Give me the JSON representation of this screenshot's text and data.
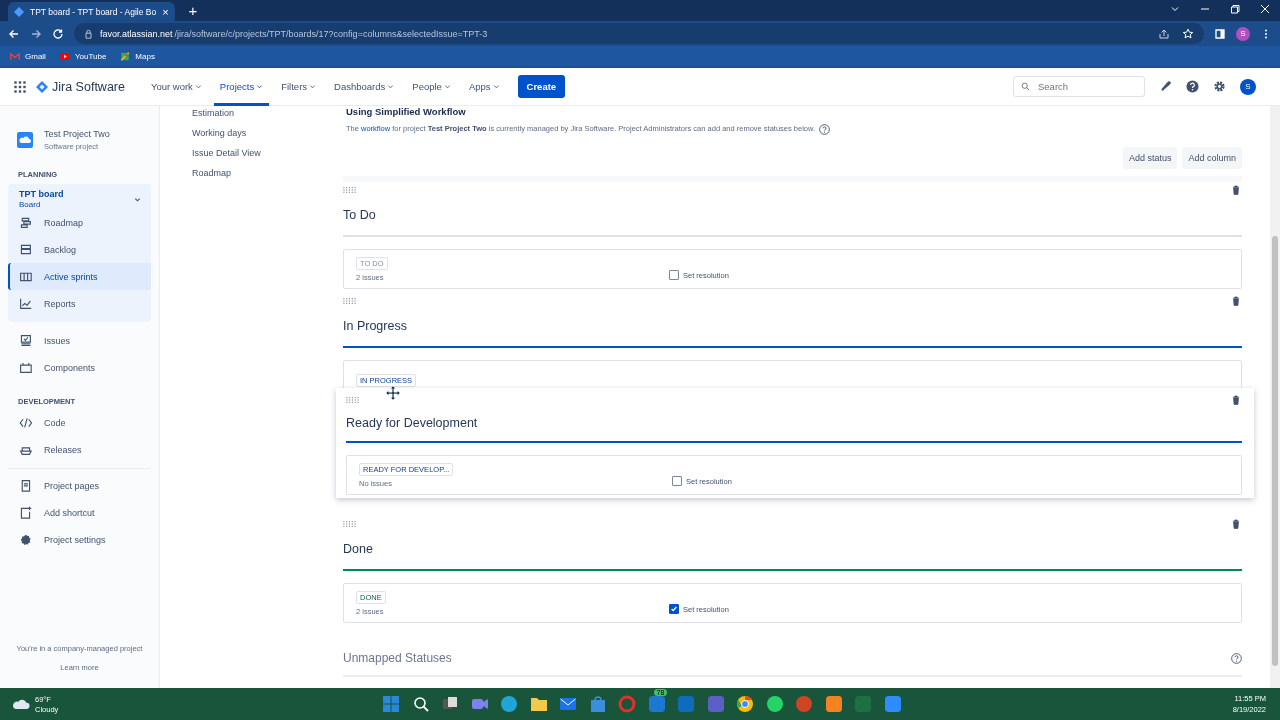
{
  "browser": {
    "tab": {
      "title": "TPT board - TPT board - Agile Bo",
      "close": "×"
    },
    "new_tab": "+",
    "url_host": "favor.atlassian.net",
    "url_path": "/jira/software/c/projects/TPT/boards/17?config=columns&selectedIssue=TPT-3",
    "profile": "S",
    "bookmarks": [
      "Gmail",
      "YouTube",
      "Maps"
    ]
  },
  "jira_nav": {
    "product": "Jira Software",
    "items": [
      {
        "label": "Your work",
        "selected": false
      },
      {
        "label": "Projects",
        "selected": true
      },
      {
        "label": "Filters",
        "selected": false
      },
      {
        "label": "Dashboards",
        "selected": false
      },
      {
        "label": "People",
        "selected": false
      },
      {
        "label": "Apps",
        "selected": false
      }
    ],
    "create": "Create",
    "search": {
      "placeholder": "Search"
    },
    "avatar": "S"
  },
  "sidebar": {
    "project": {
      "name": "Test Project Two",
      "type": "Software project"
    },
    "planning_label": "PLANNING",
    "board": {
      "name": "TPT board",
      "type": "Board",
      "expanded": true,
      "items": [
        {
          "label": "Roadmap",
          "selected": false
        },
        {
          "label": "Backlog",
          "selected": false
        },
        {
          "label": "Active sprints",
          "selected": true
        },
        {
          "label": "Reports",
          "selected": false
        }
      ]
    },
    "items": [
      "Issues",
      "Components"
    ],
    "development_label": "DEVELOPMENT",
    "development_items": [
      "Code",
      "Releases"
    ],
    "bottom_items": [
      "Project pages",
      "Add shortcut",
      "Project settings"
    ],
    "footer": "You're in a company-managed project",
    "learn_more": "Learn more"
  },
  "settings_menu": [
    "Estimation",
    "Working days",
    "Issue Detail View",
    "Roadmap"
  ],
  "workflow": {
    "title": "Using Simplified Workflow",
    "description": [
      {
        "kind": "text",
        "text": "The "
      },
      {
        "kind": "link",
        "text": "workflow"
      },
      {
        "kind": "text",
        "text": " for project "
      },
      {
        "kind": "bold",
        "text": "Test Project Two"
      },
      {
        "kind": "text",
        "text": " is currently managed by Jira Software. Project Administrators can add and remove statuses below."
      }
    ],
    "buttons": [
      "Add status",
      "Add column"
    ]
  },
  "columns": [
    {
      "name": "To Do",
      "color": "#dfe1e6",
      "status": "TO DO",
      "count": "2 issues",
      "resolution_label": "Set resolution",
      "set_resolution": false
    },
    {
      "name": "In Progress",
      "color": "#0052cc",
      "status": "IN PROGRESS"
    },
    {
      "kind": "placeholder"
    },
    {
      "name": "Done",
      "color": "#00875a",
      "status": "DONE",
      "count": "2 issues",
      "resolution_label": "Set resolution",
      "set_resolution": true
    }
  ],
  "dragged_column": {
    "name": "Ready for Development",
    "color": "#0052cc",
    "status": "READY FOR DEVELOP...",
    "count": "No issues",
    "resolution_label": "Set resolution",
    "set_resolution": false
  },
  "unmapped": {
    "title": "Unmapped Statuses"
  },
  "taskbar": {
    "weather": {
      "temp": "69°F",
      "condition": "Cloudy"
    },
    "badge": "78",
    "time": "11:55 PM",
    "date": "8/19/2022"
  }
}
